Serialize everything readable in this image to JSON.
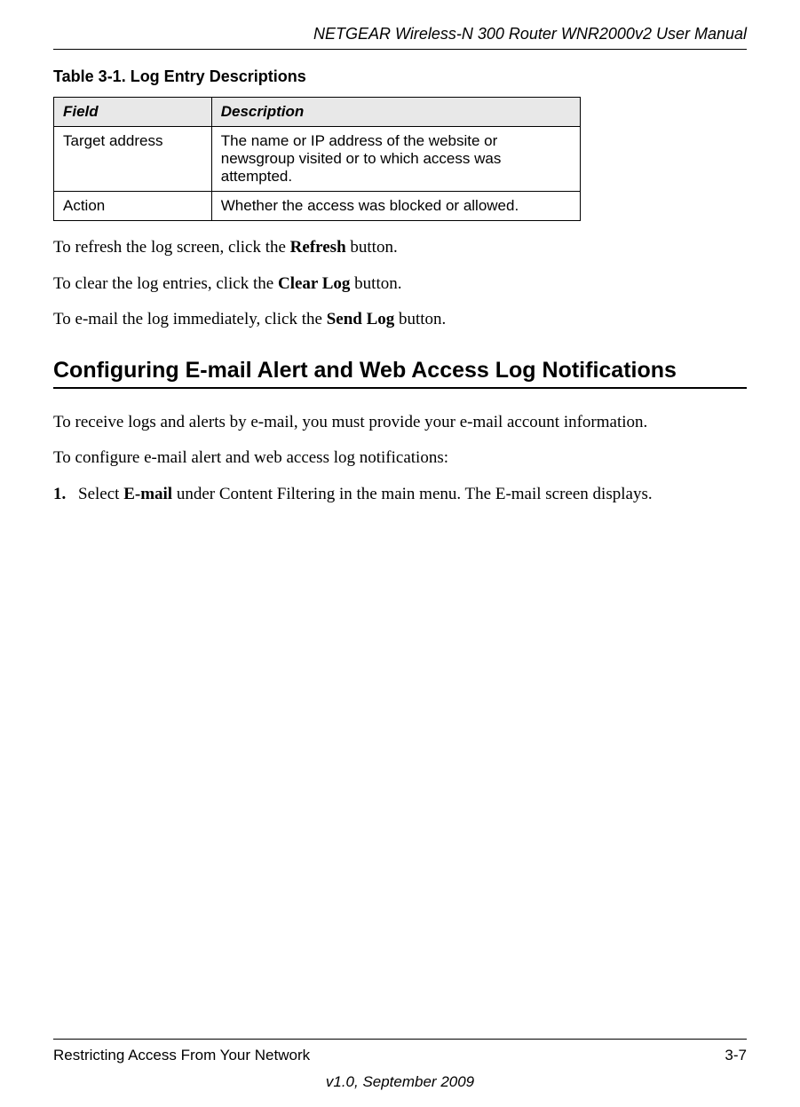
{
  "header": {
    "title": "NETGEAR Wireless-N 300 Router WNR2000v2 User Manual"
  },
  "table": {
    "caption": "Table 3-1.  Log Entry Descriptions",
    "headers": {
      "field": "Field",
      "description": "Description"
    },
    "rows": [
      {
        "field": "Target address",
        "description": "The name or IP address of the website or newsgroup visited or to which access was attempted."
      },
      {
        "field": "Action",
        "description": "Whether the access was blocked or allowed."
      }
    ]
  },
  "paragraphs": {
    "p1_a": "To refresh the log screen, click the ",
    "p1_b": "Refresh",
    "p1_c": " button.",
    "p2_a": "To clear the log entries, click the ",
    "p2_b": "Clear Log",
    "p2_c": " button.",
    "p3_a": "To e-mail the log immediately, click the ",
    "p3_b": "Send Log",
    "p3_c": " button."
  },
  "section": {
    "heading": "Configuring E-mail Alert and Web Access Log Notifications",
    "intro1": "To receive logs and alerts by e-mail, you must provide your e-mail account information.",
    "intro2": "To configure e-mail alert and web access log notifications:",
    "step1_num": "1.",
    "step1_a": "Select ",
    "step1_b": "E-mail",
    "step1_c": " under Content Filtering in the main menu. The E-mail screen displays."
  },
  "footer": {
    "left": "Restricting Access From Your Network",
    "right": "3-7",
    "version": "v1.0, September 2009"
  }
}
